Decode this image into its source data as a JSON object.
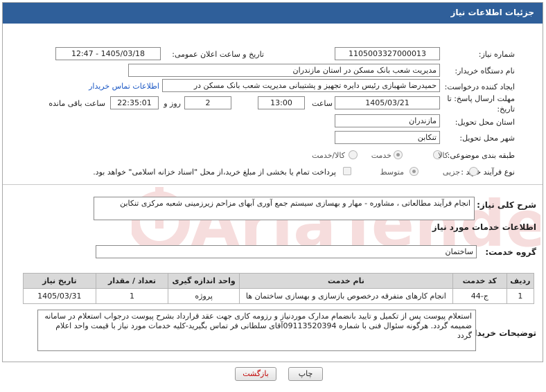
{
  "header": {
    "title": "جزئیات اطلاعات نیاز"
  },
  "fields": {
    "need_number": {
      "label": "شماره نیاز:",
      "value": "1105003327000013"
    },
    "announce_datetime": {
      "label": "تاریخ و ساعت اعلان عمومی:",
      "value": "1405/03/18 - 12:47"
    },
    "buyer_org": {
      "label": "نام دستگاه خریدار:",
      "value": "مدیریت شعب بانک مسکن در استان مازندران"
    },
    "requester": {
      "label": "ایجاد کننده درخواست:",
      "value": "حمیدرضا شهبازی رئیس دایره تجهیز و پشتیبانی  مدیریت شعب بانک مسکن در",
      "contact_link": "اطلاعات تماس خریدار"
    },
    "deadline": {
      "label_line1": "مهلت ارسال پاسخ: تا",
      "label_line2": "تاریخ:",
      "date": "1405/03/21",
      "time_label": "ساعت",
      "time": "13:00",
      "days": "2",
      "days_label": "روز و",
      "remaining": "22:35:01",
      "remaining_label": "ساعت باقی مانده"
    },
    "province": {
      "label": "استان محل تحویل:",
      "value": "مازندران"
    },
    "city": {
      "label": "شهر محل تحویل:",
      "value": "تنکابن"
    },
    "category": {
      "label": "طبقه بندی موضوعی:",
      "options": [
        "کالا",
        "خدمت",
        "کالا/خدمت"
      ],
      "selected": "خدمت"
    },
    "purchase_type": {
      "label": "نوع فرآیند خرید :",
      "options": [
        "جزیی",
        "متوسط"
      ],
      "selected": "متوسط",
      "payment_note": "پرداخت تمام یا بخشی از مبلغ خرید،از محل \"اسناد خزانه اسلامی\" خواهد بود."
    }
  },
  "description": {
    "label": "شرح کلی نیاز:",
    "text": "انجام فرآیند مطالعاتی ، مشاوره - مهار و بهسازی سیستم جمع آوری آبهای مزاحم زیرزمینی شعبه مرکزی تنکابن"
  },
  "services": {
    "section_title": "اطلاعات خدمات مورد نیاز",
    "group_label": "گروه خدمت:",
    "group_value": "ساختمان",
    "table": {
      "headers": [
        "ردیف",
        "کد خدمت",
        "نام خدمت",
        "واحد اندازه گیری",
        "تعداد / مقدار",
        "تاریخ نیاز"
      ],
      "rows": [
        [
          "1",
          "ج-44",
          "انجام کارهای متفرقه درخصوص بازسازی و بهسازی ساختمان ها",
          "پروژه",
          "1",
          "1405/03/31"
        ]
      ]
    }
  },
  "buyer_notes": {
    "label": "توضیحات خریدار:",
    "text": "استعلام پیوست پس از تکمیل و تایید بانضمام مدارک موردنیاز و رزومه کاری جهت عقد قرارداد بشرح پیوست درجواب استعلام در سامانه ضمیمه گردد. هرگونه سئوال فنی با شماره 09113520394آقای سلطانی فر تماس بگیرید-کلیه خدمات مورد نیاز با قیمت واحد اعلام گردد"
  },
  "buttons": {
    "print": "چاپ",
    "back": "بازگشت"
  },
  "watermark": {
    "text": "AriaTender.neT"
  },
  "colors": {
    "header": "#2f5f9a",
    "link": "#1a57c4",
    "back_text": "#c00000"
  }
}
